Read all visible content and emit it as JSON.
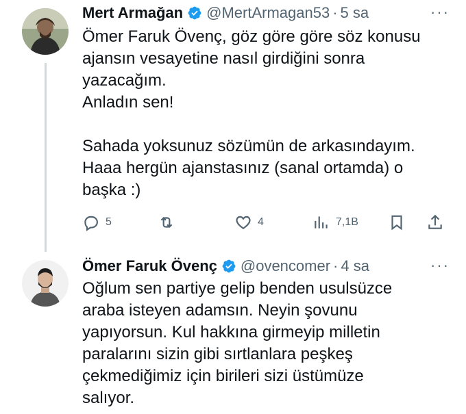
{
  "tweets": [
    {
      "author_name": "Mert Armağan",
      "handle": "@MertArmagan53",
      "dot": "·",
      "time": "5 sa",
      "more": "···",
      "text": "Ömer Faruk Övenç, göz göre göre söz konusu\najansın vesayetine nasıl girdiğini sonra\nyazacağım.\nAnladın sen!\n\nSahada yoksunuz sözümün de arkasındayım.\nHaaa hergün ajanstasınız (sanal ortamda) o\nbaşka :)",
      "actions": {
        "reply_count": "5",
        "like_count": "4",
        "views_count": "7,1B"
      }
    },
    {
      "author_name": "Ömer Faruk Övenç",
      "handle": "@ovencomer",
      "dot": "·",
      "time": "4 sa",
      "more": "···",
      "text": "Oğlum sen partiye gelip benden usulsüzce\naraba isteyen adamsın. Neyin şovunu\nyapıyorsun. Kul hakkına girmeyip milletin\nparalarını sizin gibi sırtlanlara peşkeş\nçekmediğimiz için birileri sizi üstümüze\nsalıyor."
    }
  ],
  "icons": {
    "verified": "verified-badge-icon",
    "reply": "reply-icon",
    "retweet": "retweet-icon",
    "like": "heart-icon",
    "views": "views-icon",
    "bookmark": "bookmark-icon",
    "share": "share-icon"
  },
  "colors": {
    "verified_blue": "#1d9bf0",
    "secondary_text": "#536471",
    "thread_line": "#cfd9de"
  }
}
